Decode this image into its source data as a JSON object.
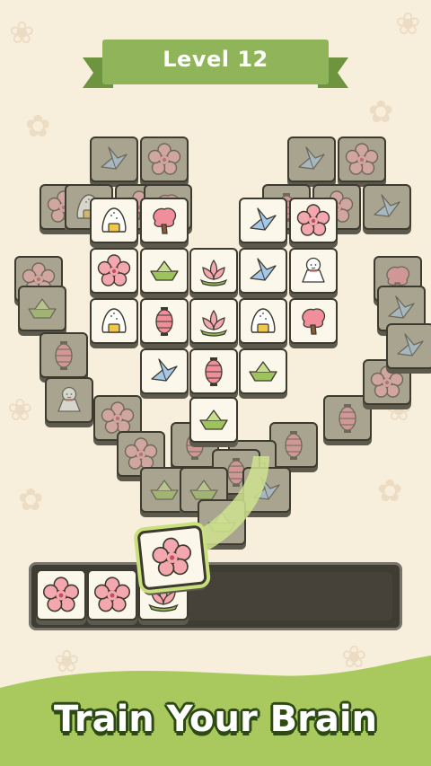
{
  "level": {
    "title": "Level 12"
  },
  "tagline": "Train Your Brain",
  "colors": {
    "banner": "#8fb45a",
    "hill": "#a9c95e",
    "tray": "#3f3c33",
    "tile_face": "#fbf7ea",
    "tile_dim": "#a8a490"
  },
  "board": {
    "icons": [
      "rice-ball-icon",
      "cherry-blossom-tree-icon",
      "paper-crane-icon",
      "sakura-flower-icon",
      "paper-boat-icon",
      "lotus-icon",
      "teru-teru-bozu-icon",
      "paper-lantern-icon"
    ]
  },
  "tray": {
    "capacity": 7,
    "slots_filled": 3,
    "tiles": [
      "sakura-flower-icon",
      "sakura-flower-icon",
      "lotus-icon"
    ]
  },
  "moving_tile": "sakura-flower-icon"
}
